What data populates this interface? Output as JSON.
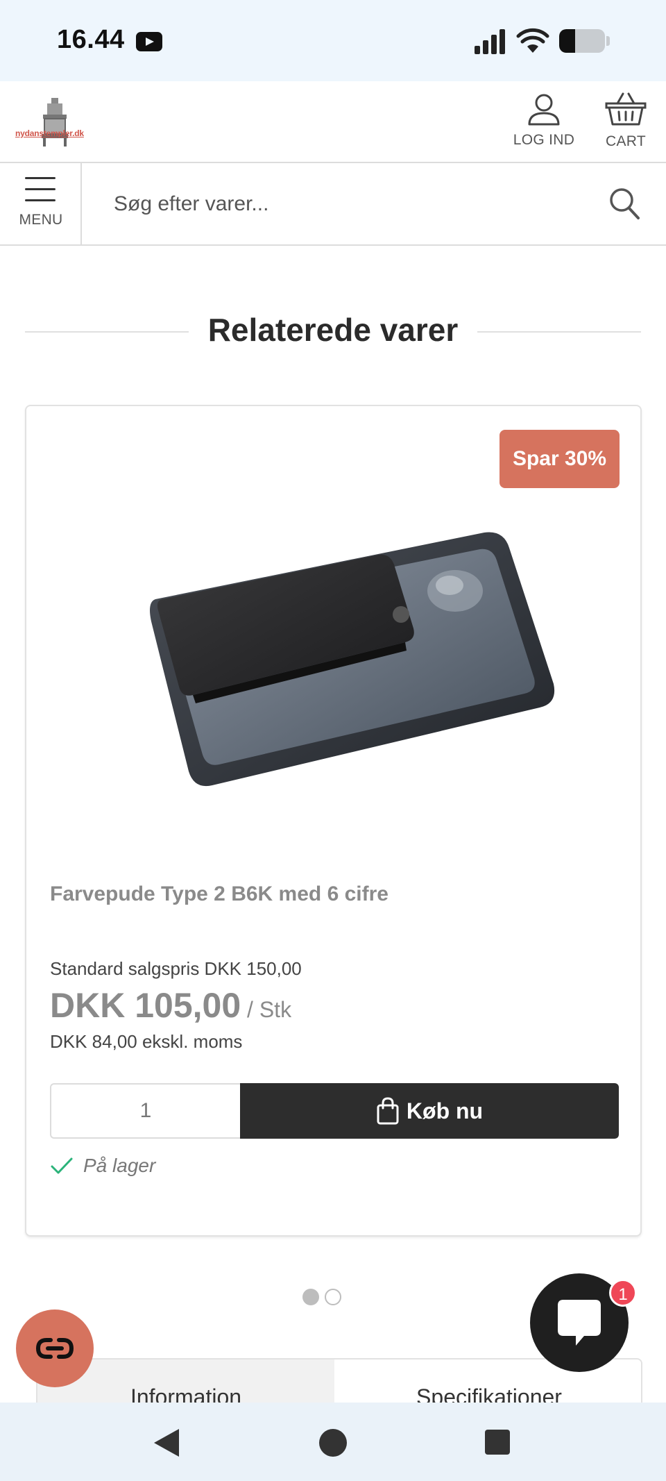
{
  "status_bar": {
    "time": "16.44",
    "battery_level": 0.35
  },
  "header": {
    "logo_text": "nydanstempler.dk",
    "login_label": "LOG IND",
    "cart_label": "CART"
  },
  "search": {
    "menu_label": "MENU",
    "placeholder": "Søg efter varer..."
  },
  "section": {
    "title": "Relaterede varer"
  },
  "product": {
    "badge": "Spar 30%",
    "name": "Farvepude Type 2 B6K med 6 cifre",
    "standard_price": "Standard salgspris DKK 150,00",
    "price": "DKK 105,00",
    "unit": " / Stk",
    "price_ex_vat": "DKK 84,00 ekskl. moms",
    "quantity": "1",
    "buy_label": "Køb nu",
    "stock_status": "På lager"
  },
  "carousel": {
    "active_index": 0,
    "count": 2
  },
  "tabs": [
    {
      "label": "Information"
    },
    {
      "label": "Specifikationer"
    }
  ],
  "chat": {
    "badge_count": "1"
  },
  "colors": {
    "accent": "#d6735e",
    "dark": "#2d2d2d",
    "stock_check": "#2bb37a",
    "chat_badge": "#ef4757"
  },
  "icons": {
    "login": "user-icon",
    "cart": "basket-icon",
    "menu": "hamburger-icon",
    "search": "search-icon",
    "buy": "shopping-bag-icon",
    "stock": "check-icon",
    "chat": "chat-bubble-icon",
    "accessibility": "link-icon"
  }
}
